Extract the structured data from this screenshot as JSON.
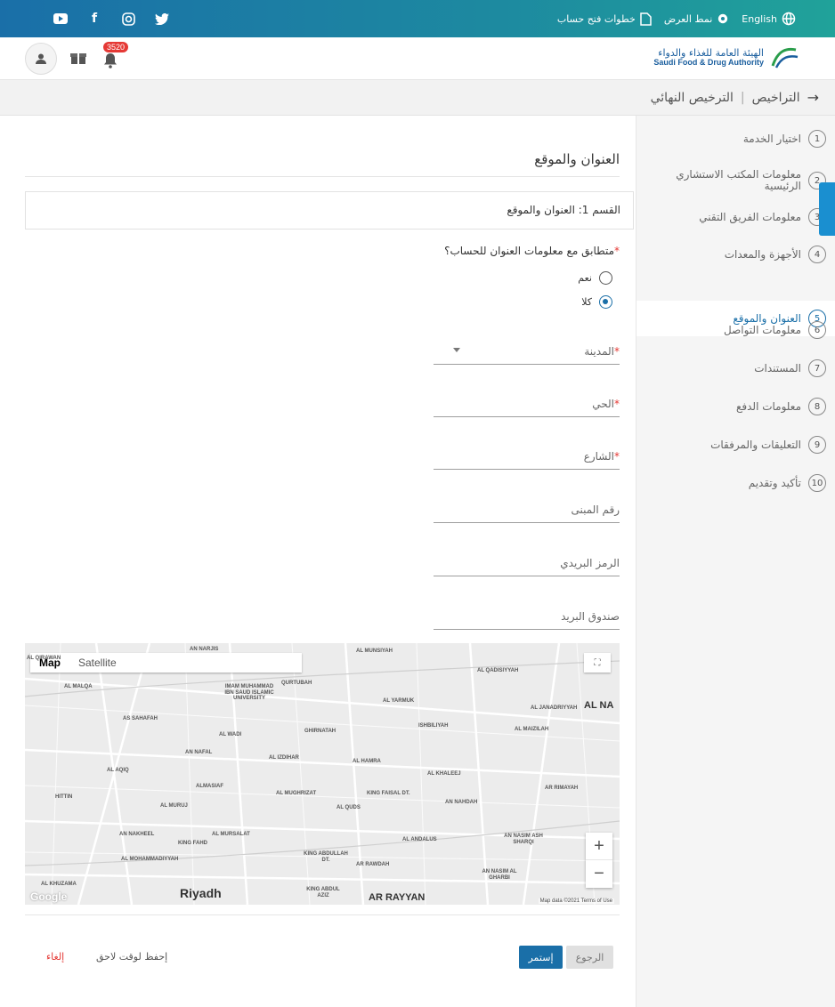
{
  "topbar": {
    "language": "English",
    "display_mode": "نمط العرض",
    "account_steps": "خطوات فتح حساب",
    "social_icons": [
      "youtube-icon",
      "facebook-icon",
      "instagram-icon",
      "twitter-icon"
    ]
  },
  "header": {
    "logo_ar": "الهيئة العامة للغذاء والدواء",
    "logo_en": "Saudi Food & Drug Authority",
    "notifications_count": "3520"
  },
  "breadcrumb": {
    "parent": "التراخيص",
    "current": "الترخيص النهائي"
  },
  "sidebar": {
    "steps": [
      {
        "num": "1",
        "label": "اختيار الخدمة"
      },
      {
        "num": "2",
        "label": "معلومات المكتب الاستشاري الرئيسية"
      },
      {
        "num": "3",
        "label": "معلومات الفريق التقني"
      },
      {
        "num": "4",
        "label": "الأجهزة والمعدات"
      },
      {
        "num": "5",
        "label": "العنوان والموقع"
      },
      {
        "num": "6",
        "label": "معلومات التواصل"
      },
      {
        "num": "7",
        "label": "المستندات"
      },
      {
        "num": "8",
        "label": "معلومات الدفع"
      },
      {
        "num": "9",
        "label": "التعليقات والمرفقات"
      },
      {
        "num": "10",
        "label": "تأكيد وتقديم"
      }
    ],
    "active_step": "5"
  },
  "main": {
    "title": "العنوان والموقع",
    "section_label": "القسم 1: العنوان والموقع",
    "question": "متطابق مع معلومات العنوان للحساب؟",
    "options": [
      "نعم",
      "كلا"
    ],
    "selected_option": "كلا",
    "fields": {
      "city": "المدينة",
      "district": "الحي",
      "street": "الشارع",
      "building": "رقم المبنى",
      "postal": "الرمز البريدي",
      "pobox": "صندوق البريد"
    }
  },
  "map": {
    "type_map": "Map",
    "type_satellite": "Satellite",
    "city_label": "Riyadh",
    "district_label": "AR RAYYAN",
    "attribution": "Map data ©2021   Terms of Use",
    "google": "Google",
    "labels": [
      "AN NARJIS",
      "AL QIRAWAN",
      "AL MUNSIYAH",
      "AL QADISIYYAH",
      "AL MALQA",
      "IMAM MUHAMMAD IBN SAUD ISLAMIC UNIVERSITY",
      "QURTUBAH",
      "AL YARMUK",
      "AL JANADRIYYAH",
      "AL NA",
      "AS SAHAFAH",
      "ISHBILIYAH",
      "AL MAIZILAH",
      "AN NAFAL",
      "AL WADI",
      "GHIRNATAH",
      "AL IZDIHAR",
      "AL HAMRA",
      "AL AQIQ",
      "AL KHALEEJ",
      "ALMASIAF",
      "AL MUGHRIZAT",
      "KING FAISAL DT.",
      "AR RIMAYAH",
      "HITTIN",
      "AL MURUJ",
      "AL QUDS",
      "AN NAHDAH",
      "AN NAKHEEL",
      "AL MURSALAT",
      "KING FAHD",
      "AL ANDALUS",
      "AN NASIM ASH SHARQI",
      "AL MOHAMMADIYYAH",
      "KING ABDULLAH DT.",
      "AR RAWDAH",
      "AN NASIM AL GHARBI",
      "AL KHUZAMA",
      "KING ABDUL AZIZ"
    ]
  },
  "actions": {
    "next": "إستمر",
    "back": "الرجوع",
    "save_later": "إحفظ لوقت لاحق",
    "cancel": "إلغاء"
  },
  "colors": {
    "primary": "#1a6fa8",
    "danger": "#e53935",
    "topbar_start": "#1a6fa8",
    "topbar_end": "#20a29a"
  }
}
